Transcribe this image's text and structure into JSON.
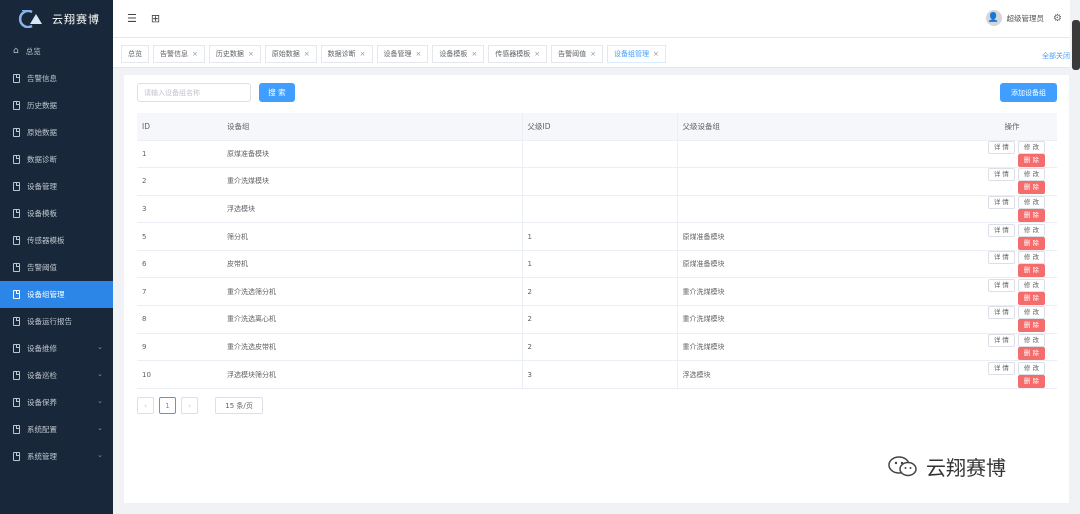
{
  "brand": {
    "name": "云翔赛博"
  },
  "sidebar": {
    "items": [
      {
        "label": "总览",
        "icon": "home-icon"
      },
      {
        "label": "告警信息",
        "icon": "doc-icon"
      },
      {
        "label": "历史数据",
        "icon": "doc-icon"
      },
      {
        "label": "原始数据",
        "icon": "doc-icon"
      },
      {
        "label": "数据诊断",
        "icon": "doc-icon"
      },
      {
        "label": "设备管理",
        "icon": "doc-icon"
      },
      {
        "label": "设备模板",
        "icon": "doc-icon"
      },
      {
        "label": "传感器模板",
        "icon": "doc-icon"
      },
      {
        "label": "告警阈值",
        "icon": "doc-icon"
      },
      {
        "label": "设备组管理",
        "icon": "doc-icon",
        "active": true
      },
      {
        "label": "设备运行报告",
        "icon": "doc-icon"
      },
      {
        "label": "设备维修",
        "icon": "doc-icon",
        "expandable": true
      },
      {
        "label": "设备巡检",
        "icon": "doc-icon",
        "expandable": true
      },
      {
        "label": "设备保养",
        "icon": "doc-icon",
        "expandable": true
      },
      {
        "label": "系统配置",
        "icon": "doc-icon",
        "expandable": true
      },
      {
        "label": "系统管理",
        "icon": "doc-icon",
        "expandable": true
      }
    ]
  },
  "header": {
    "menu_icon": "☰",
    "grid_icon": "⊞",
    "user_name": "超级管理员",
    "settings_icon": "⚙"
  },
  "tabs": {
    "items": [
      {
        "label": "总览",
        "closable": false
      },
      {
        "label": "告警信息",
        "closable": true
      },
      {
        "label": "历史数据",
        "closable": true
      },
      {
        "label": "原始数据",
        "closable": true
      },
      {
        "label": "数据诊断",
        "closable": true
      },
      {
        "label": "设备管理",
        "closable": true
      },
      {
        "label": "设备模板",
        "closable": true
      },
      {
        "label": "传感器模板",
        "closable": true
      },
      {
        "label": "告警阈值",
        "closable": true
      },
      {
        "label": "设备组管理",
        "closable": true,
        "active": true
      }
    ],
    "close_all": "全部关闭"
  },
  "toolbar": {
    "search_placeholder": "请输入设备组名称",
    "search_button": "搜 索",
    "add_button": "添加设备组"
  },
  "table": {
    "columns": [
      "ID",
      "设备组",
      "父级ID",
      "父级设备组",
      "操作"
    ],
    "actions": [
      "详 情",
      "修 改",
      "删 除"
    ],
    "rows": [
      [
        "1",
        "原煤准备模块",
        "",
        ""
      ],
      [
        "2",
        "重介洗煤模块",
        "",
        ""
      ],
      [
        "3",
        "浮选模块",
        "",
        ""
      ],
      [
        "5",
        "筛分机",
        "1",
        "原煤准备模块"
      ],
      [
        "6",
        "皮带机",
        "1",
        "原煤准备模块"
      ],
      [
        "7",
        "重介洗选筛分机",
        "2",
        "重介洗煤模块"
      ],
      [
        "8",
        "重介洗选离心机",
        "2",
        "重介洗煤模块"
      ],
      [
        "9",
        "重介洗选皮带机",
        "2",
        "重介洗煤模块"
      ],
      [
        "10",
        "浮选模块筛分机",
        "3",
        "浮选模块"
      ]
    ]
  },
  "pagination": {
    "prev": "‹",
    "current": "1",
    "next": "›",
    "page_size": "15 条/页"
  },
  "watermark": {
    "text": "云翔赛博"
  },
  "colors": {
    "sidebar_bg": "#18283a",
    "primary": "#409eff",
    "danger": "#f56c6c"
  }
}
